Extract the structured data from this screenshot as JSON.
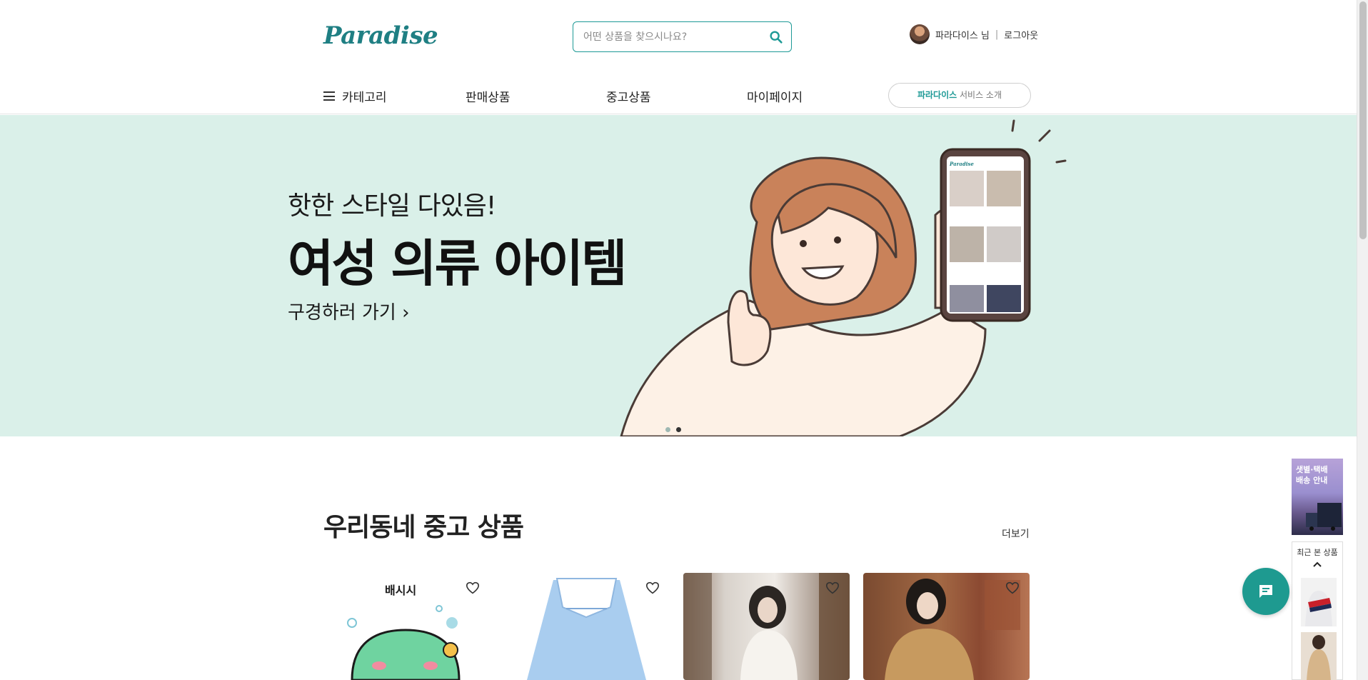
{
  "header": {
    "logo": "Paradise",
    "search": {
      "placeholder": "어떤 상품을 찾으시나요?",
      "value": ""
    },
    "user": {
      "name": "파라다이스 님",
      "separator": "|",
      "logout": "로그아웃"
    }
  },
  "nav": {
    "items": [
      {
        "label": "카테고리",
        "icon": "hamburger-icon"
      },
      {
        "label": "판매상품"
      },
      {
        "label": "중고상품"
      },
      {
        "label": "마이페이지"
      }
    ],
    "service": {
      "brand": "파라다이스",
      "label": " 서비스 소개"
    }
  },
  "banner": {
    "subtitle": "핫한 스타일 다있음!",
    "title": "여성 의류 아이템",
    "cta": "구경하러 가기",
    "slide_count": 2,
    "active_slide": 2,
    "phone_logo": "Paradise"
  },
  "section": {
    "title": "우리동네 중고 상품",
    "more": "더보기",
    "cards": [
      {
        "caption": "배시시"
      },
      {
        "caption": ""
      },
      {
        "caption": ""
      },
      {
        "caption": ""
      }
    ]
  },
  "side": {
    "ad_text": "샛별·택배\n배송 안내",
    "recent_title": "최근 본 상품",
    "close": "×"
  },
  "colors": {
    "brand": "#1f7f83",
    "accent": "#1e9a96",
    "banner_bg": "#daf0e9",
    "chat": "#1e9a90"
  }
}
